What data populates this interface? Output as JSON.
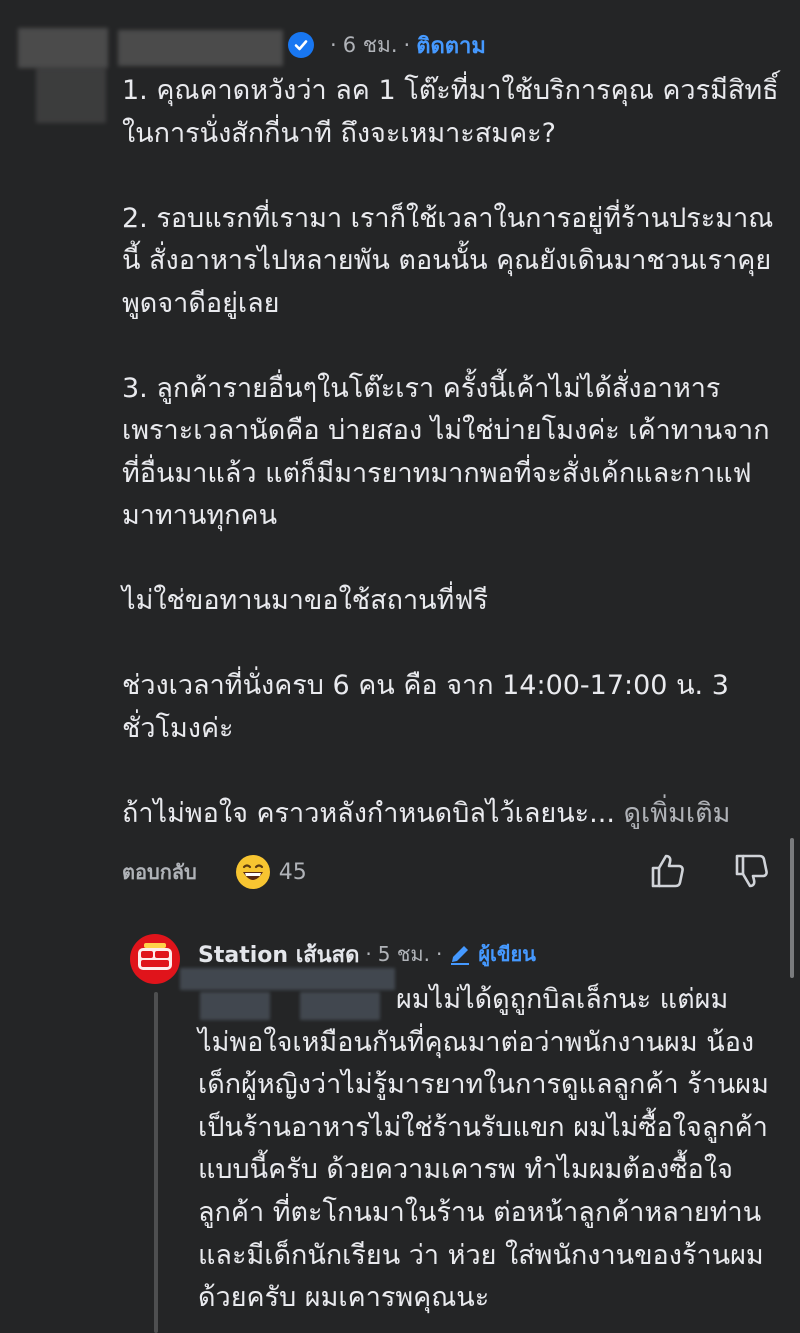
{
  "comment": {
    "time": "6 ชม.",
    "follow_label": "ติดตาม",
    "paragraphs": [
      "1. คุณคาดหวังว่า ลค 1 โต๊ะที่มาใช้บริการคุณ ควรมีสิทธิ์ในการนั่งสักกี่นาที ถึงจะเหมาะสมคะ?",
      "2. รอบแรกที่เรามา เราก็ใช้เวลาในการอยู่ที่ร้านประมาณนี้ สั่งอาหารไปหลายพัน ตอนนั้น คุณยังเดินมาชวนเราคุย พูดจาดีอยู่เลย",
      "3. ลูกค้ารายอื่นๆในโต๊ะเรา ครั้งนี้เค้าไม่ได้สั่งอาหาร เพราะเวลานัดคือ บ่ายสอง ไม่ใช่บ่ายโมงค่ะ เค้าทานจากที่อื่นมาแล้ว แต่ก็มีมารยาทมากพอที่จะสั่งเค้กและกาแฟมาทานทุกคน",
      "ไม่ใช่ขอทานมาขอใช้สถานที่ฟรี",
      "ช่วงเวลาที่นั่งครบ 6 คน คือ จาก 14:00-17:00 น. 3 ชั่วโมงค่ะ"
    ],
    "last_line": "ถ้าไม่พอใจ คราวหลังกำหนดบิลไว้เลยนะ...",
    "see_more": "ดูเพิ่มเติม",
    "reply_label": "ตอบกลับ",
    "reaction_count": "45"
  },
  "reply": {
    "author": "Station เส้นสด",
    "time": "5 ชม.",
    "author_badge": "ผู้เขียน",
    "first_line": "ผมไม่ได้ดูถูกบิลเล็กนะ แต่ผม",
    "text": "ไม่พอใจเหมือนกันที่คุณมาต่อว่าพนักงานผม น้องเด็กผู้หญิงว่าไม่รู้มารยาทในการดูแลลูกค้า ร้านผมเป็นร้านอาหารไม่ใช่ร้านรับแขก ผมไม่ซื้อใจลูกค้าแบบนี้ครับ ด้วยความเคารพ ทำไมผมต้องซื้อใจลูกค้า ที่ตะโกนมาในร้าน ต่อหน้าลูกค้าหลายท่าน และมีเด็กนักเรียน ว่า ห่วย ใส่พนักงานของร้านผมด้วยครับ ผมเคารพคุณนะ"
  },
  "colors": {
    "background": "#242526",
    "accent": "#4599ff",
    "secondary_text": "#b0b3b8",
    "page_avatar": "#e0141b"
  },
  "icons": {
    "verified": "verified-badge-icon",
    "reaction": "grinning-face-icon",
    "like": "thumbs-up-icon",
    "dislike": "thumbs-down-icon",
    "author": "pencil-icon"
  }
}
